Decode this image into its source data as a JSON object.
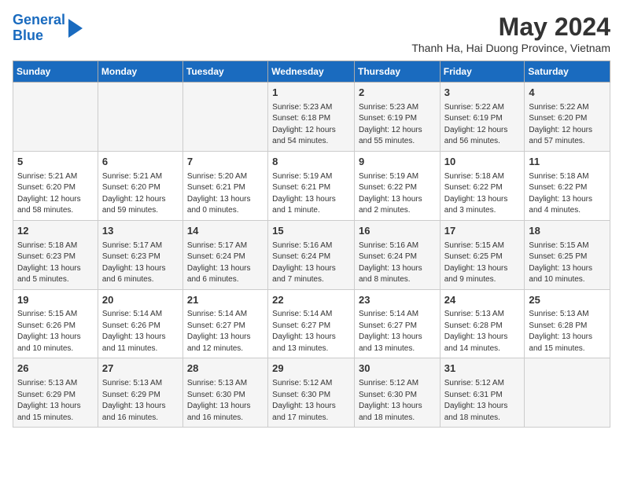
{
  "header": {
    "logo_line1": "General",
    "logo_line2": "Blue",
    "month_title": "May 2024",
    "subtitle": "Thanh Ha, Hai Duong Province, Vietnam"
  },
  "days_of_week": [
    "Sunday",
    "Monday",
    "Tuesday",
    "Wednesday",
    "Thursday",
    "Friday",
    "Saturday"
  ],
  "weeks": [
    [
      {
        "day": "",
        "info": ""
      },
      {
        "day": "",
        "info": ""
      },
      {
        "day": "",
        "info": ""
      },
      {
        "day": "1",
        "info": "Sunrise: 5:23 AM\nSunset: 6:18 PM\nDaylight: 12 hours and 54 minutes."
      },
      {
        "day": "2",
        "info": "Sunrise: 5:23 AM\nSunset: 6:19 PM\nDaylight: 12 hours and 55 minutes."
      },
      {
        "day": "3",
        "info": "Sunrise: 5:22 AM\nSunset: 6:19 PM\nDaylight: 12 hours and 56 minutes."
      },
      {
        "day": "4",
        "info": "Sunrise: 5:22 AM\nSunset: 6:20 PM\nDaylight: 12 hours and 57 minutes."
      }
    ],
    [
      {
        "day": "5",
        "info": "Sunrise: 5:21 AM\nSunset: 6:20 PM\nDaylight: 12 hours and 58 minutes."
      },
      {
        "day": "6",
        "info": "Sunrise: 5:21 AM\nSunset: 6:20 PM\nDaylight: 12 hours and 59 minutes."
      },
      {
        "day": "7",
        "info": "Sunrise: 5:20 AM\nSunset: 6:21 PM\nDaylight: 13 hours and 0 minutes."
      },
      {
        "day": "8",
        "info": "Sunrise: 5:19 AM\nSunset: 6:21 PM\nDaylight: 13 hours and 1 minute."
      },
      {
        "day": "9",
        "info": "Sunrise: 5:19 AM\nSunset: 6:22 PM\nDaylight: 13 hours and 2 minutes."
      },
      {
        "day": "10",
        "info": "Sunrise: 5:18 AM\nSunset: 6:22 PM\nDaylight: 13 hours and 3 minutes."
      },
      {
        "day": "11",
        "info": "Sunrise: 5:18 AM\nSunset: 6:22 PM\nDaylight: 13 hours and 4 minutes."
      }
    ],
    [
      {
        "day": "12",
        "info": "Sunrise: 5:18 AM\nSunset: 6:23 PM\nDaylight: 13 hours and 5 minutes."
      },
      {
        "day": "13",
        "info": "Sunrise: 5:17 AM\nSunset: 6:23 PM\nDaylight: 13 hours and 6 minutes."
      },
      {
        "day": "14",
        "info": "Sunrise: 5:17 AM\nSunset: 6:24 PM\nDaylight: 13 hours and 6 minutes."
      },
      {
        "day": "15",
        "info": "Sunrise: 5:16 AM\nSunset: 6:24 PM\nDaylight: 13 hours and 7 minutes."
      },
      {
        "day": "16",
        "info": "Sunrise: 5:16 AM\nSunset: 6:24 PM\nDaylight: 13 hours and 8 minutes."
      },
      {
        "day": "17",
        "info": "Sunrise: 5:15 AM\nSunset: 6:25 PM\nDaylight: 13 hours and 9 minutes."
      },
      {
        "day": "18",
        "info": "Sunrise: 5:15 AM\nSunset: 6:25 PM\nDaylight: 13 hours and 10 minutes."
      }
    ],
    [
      {
        "day": "19",
        "info": "Sunrise: 5:15 AM\nSunset: 6:26 PM\nDaylight: 13 hours and 10 minutes."
      },
      {
        "day": "20",
        "info": "Sunrise: 5:14 AM\nSunset: 6:26 PM\nDaylight: 13 hours and 11 minutes."
      },
      {
        "day": "21",
        "info": "Sunrise: 5:14 AM\nSunset: 6:27 PM\nDaylight: 13 hours and 12 minutes."
      },
      {
        "day": "22",
        "info": "Sunrise: 5:14 AM\nSunset: 6:27 PM\nDaylight: 13 hours and 13 minutes."
      },
      {
        "day": "23",
        "info": "Sunrise: 5:14 AM\nSunset: 6:27 PM\nDaylight: 13 hours and 13 minutes."
      },
      {
        "day": "24",
        "info": "Sunrise: 5:13 AM\nSunset: 6:28 PM\nDaylight: 13 hours and 14 minutes."
      },
      {
        "day": "25",
        "info": "Sunrise: 5:13 AM\nSunset: 6:28 PM\nDaylight: 13 hours and 15 minutes."
      }
    ],
    [
      {
        "day": "26",
        "info": "Sunrise: 5:13 AM\nSunset: 6:29 PM\nDaylight: 13 hours and 15 minutes."
      },
      {
        "day": "27",
        "info": "Sunrise: 5:13 AM\nSunset: 6:29 PM\nDaylight: 13 hours and 16 minutes."
      },
      {
        "day": "28",
        "info": "Sunrise: 5:13 AM\nSunset: 6:30 PM\nDaylight: 13 hours and 16 minutes."
      },
      {
        "day": "29",
        "info": "Sunrise: 5:12 AM\nSunset: 6:30 PM\nDaylight: 13 hours and 17 minutes."
      },
      {
        "day": "30",
        "info": "Sunrise: 5:12 AM\nSunset: 6:30 PM\nDaylight: 13 hours and 18 minutes."
      },
      {
        "day": "31",
        "info": "Sunrise: 5:12 AM\nSunset: 6:31 PM\nDaylight: 13 hours and 18 minutes."
      },
      {
        "day": "",
        "info": ""
      }
    ]
  ]
}
